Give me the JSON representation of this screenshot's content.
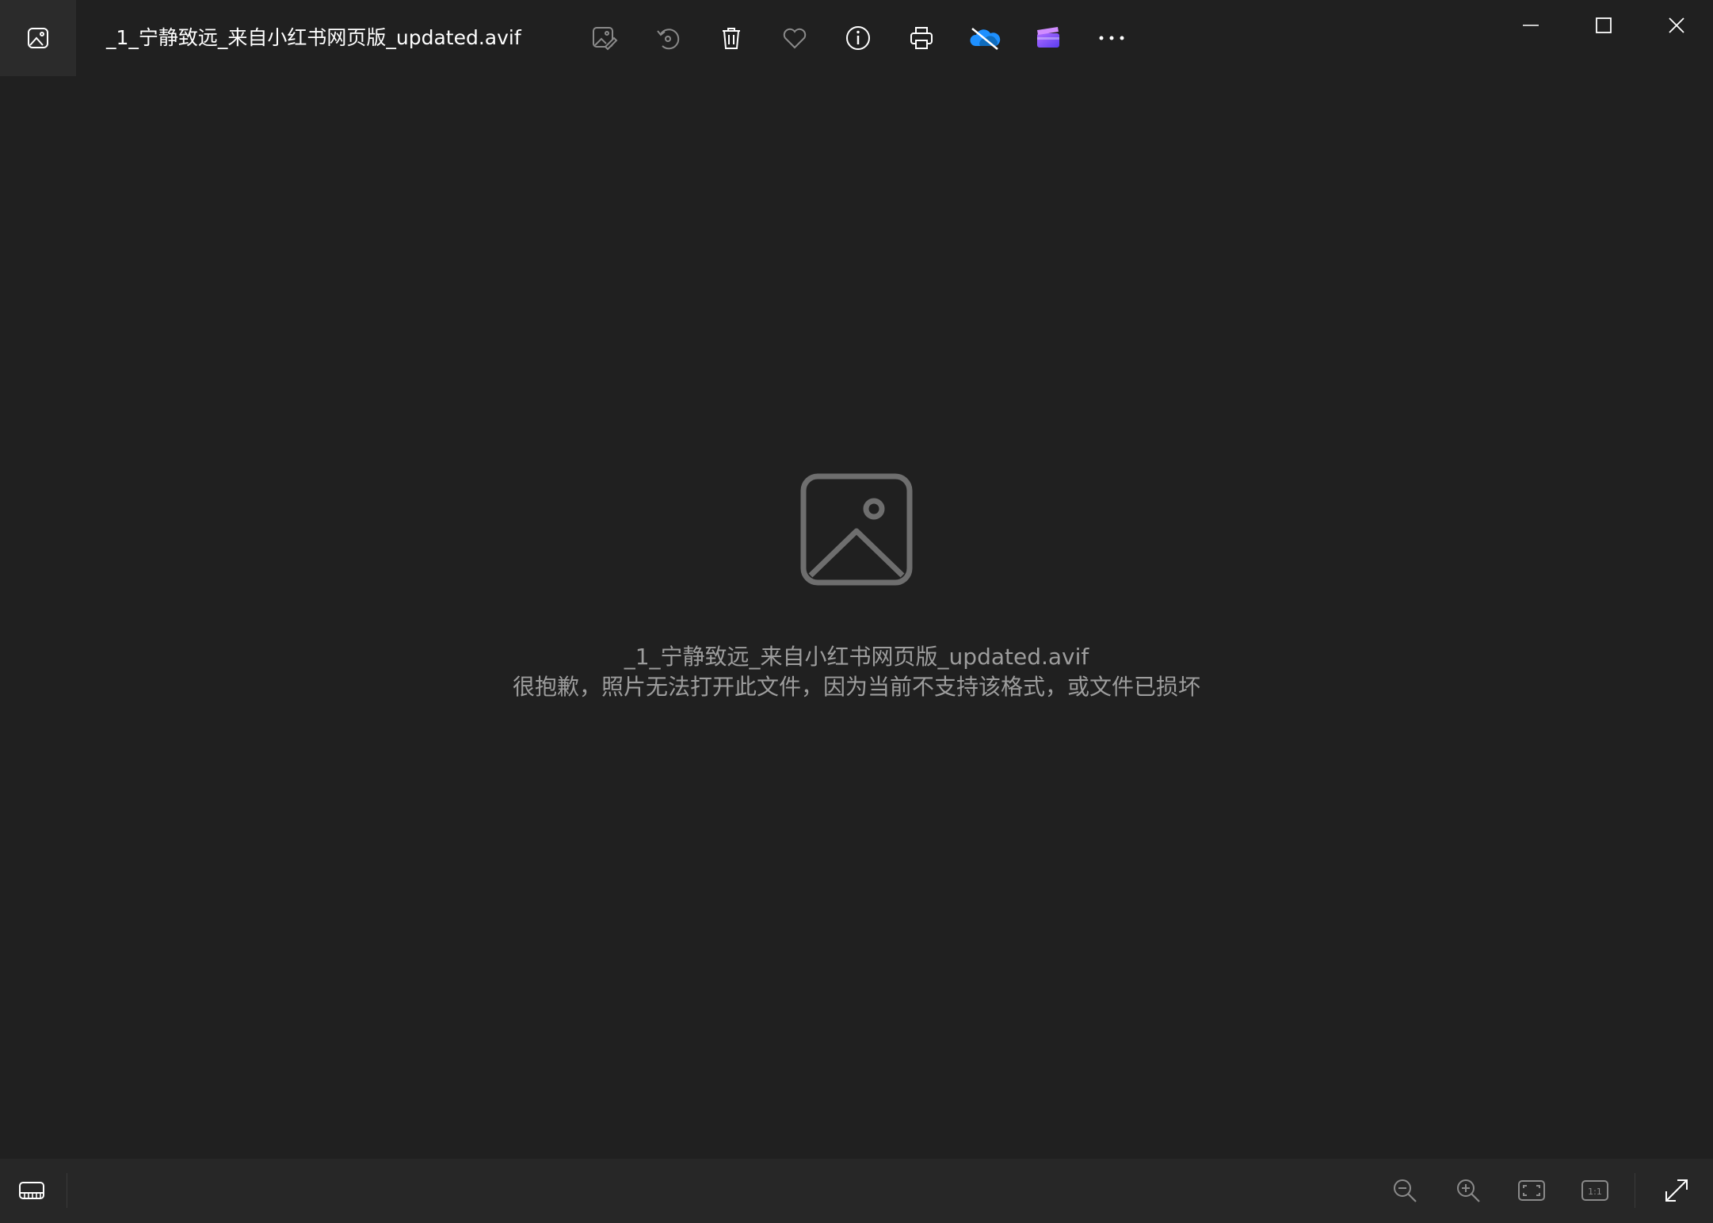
{
  "window": {
    "title": "_1_宁静致远_来自小红书网页版_updated.avif"
  },
  "toolbar": {
    "buttons": [
      {
        "name": "edit-image-icon"
      },
      {
        "name": "rotate-icon"
      },
      {
        "name": "delete-icon"
      },
      {
        "name": "favorite-icon"
      },
      {
        "name": "info-icon"
      },
      {
        "name": "print-icon"
      },
      {
        "name": "onedrive-icon"
      },
      {
        "name": "clipchamp-icon"
      },
      {
        "name": "more-icon"
      }
    ]
  },
  "window_controls": [
    "minimize-icon",
    "maximize-icon",
    "close-icon"
  ],
  "main": {
    "icon": "image-placeholder-icon",
    "filename": "_1_宁静致远_来自小红书网页版_updated.avif",
    "error_message": "很抱歉，照片无法打开此文件，因为当前不支持该格式，或文件已损坏"
  },
  "bottom_bar": {
    "left": [
      "filmstrip-icon"
    ],
    "zoom": {
      "zoom_out_label": "",
      "zoom_in_label": "",
      "actual_size_label": "1:1"
    }
  },
  "colors": {
    "background": "#202020",
    "bottom_bar": "#272727",
    "text_primary": "#ffffff",
    "text_secondary": "#9d9d9d",
    "icon_muted": "#8a8a8a",
    "onedrive_blue": "#1e90ff",
    "clipchamp_purple": "#7b5cff"
  }
}
